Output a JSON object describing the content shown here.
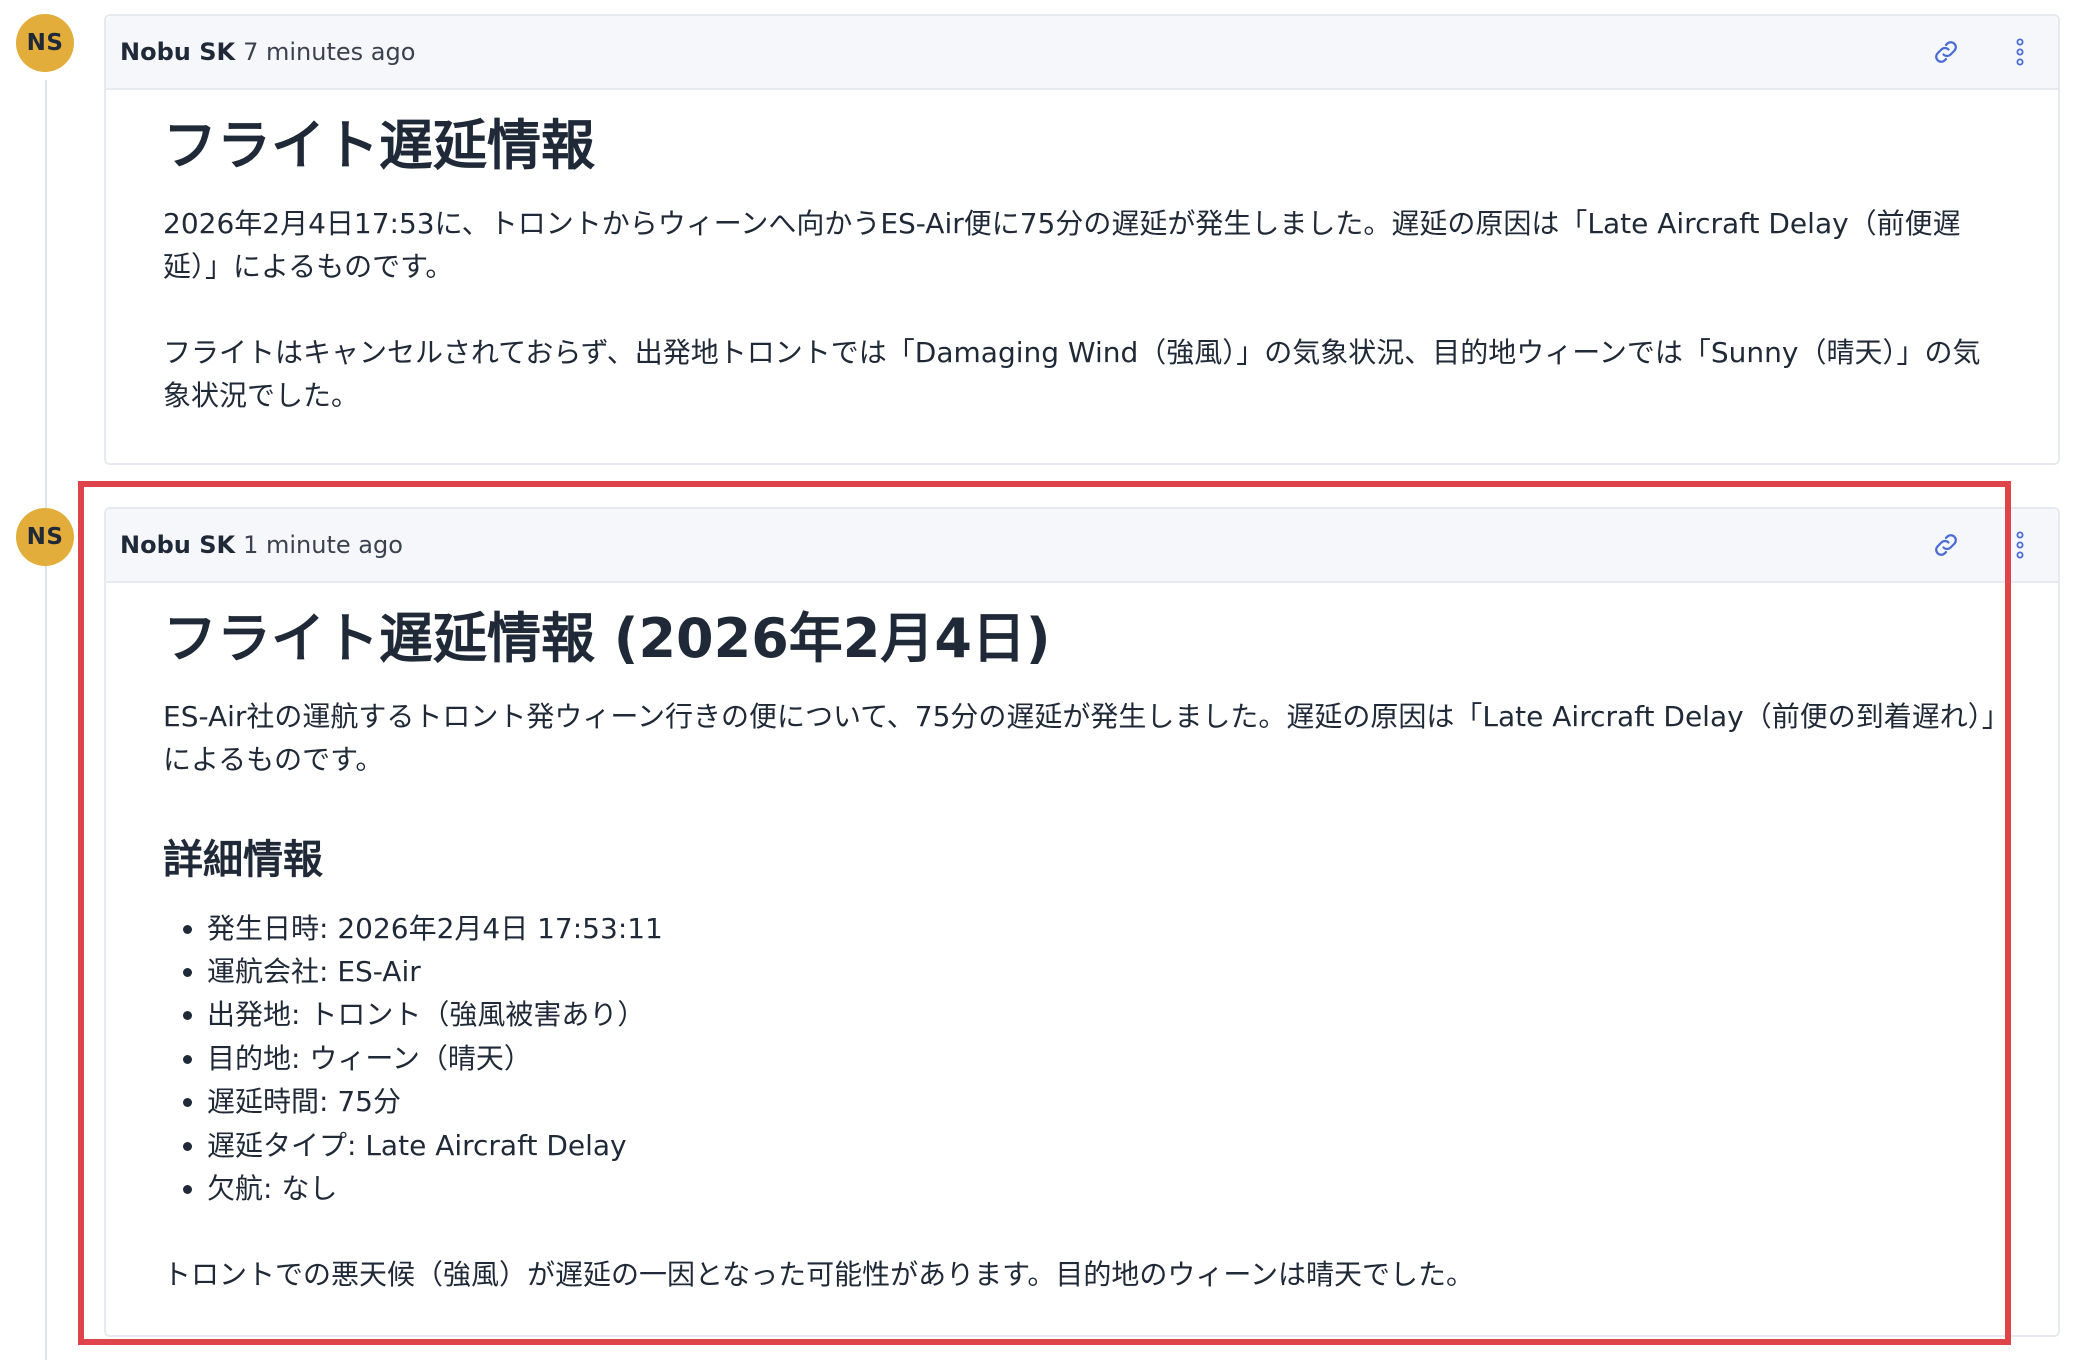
{
  "comments": [
    {
      "avatar_initials": "NS",
      "author": "Nobu SK",
      "time": "7 minutes ago",
      "title": "フライト遅延情報",
      "paragraphs": [
        "2026年2月4日17:53に、トロントからウィーンへ向かうES-Air便に75分の遅延が発生しました。遅延の原因は「Late Aircraft Delay（前便遅延）」によるものです。",
        "フライトはキャンセルされておらず、出発地トロントでは「Damaging Wind（強風）」の気象状況、目的地ウィーンでは「Sunny（晴天）」の気象状況でした。"
      ]
    },
    {
      "avatar_initials": "NS",
      "author": "Nobu SK",
      "time": "1 minute ago",
      "title": "フライト遅延情報 (2026年2月4日)",
      "intro": "ES-Air社の運航するトロント発ウィーン行きの便について、75分の遅延が発生しました。遅延の原因は「Late Aircraft Delay（前便の到着遅れ）」によるものです。",
      "details_heading": "詳細情報",
      "details": [
        "発生日時: 2026年2月4日 17:53:11",
        "運航会社: ES-Air",
        "出発地: トロント（強風被害あり）",
        "目的地: ウィーン（晴天）",
        "遅延時間: 75分",
        "遅延タイプ: Late Aircraft Delay",
        "欠航: なし"
      ],
      "closing": "トロントでの悪天候（強風）が遅延の一因となった可能性があります。目的地のウィーンは晴天でした。"
    }
  ],
  "icons": {
    "copy_link": "link-icon",
    "more_actions": "more-vertical-icon"
  },
  "colors": {
    "avatar": "#e2ad3a",
    "icon_blue": "#4a6cd4",
    "highlight_border": "#de444a",
    "header_bg": "#f6f7fa"
  }
}
